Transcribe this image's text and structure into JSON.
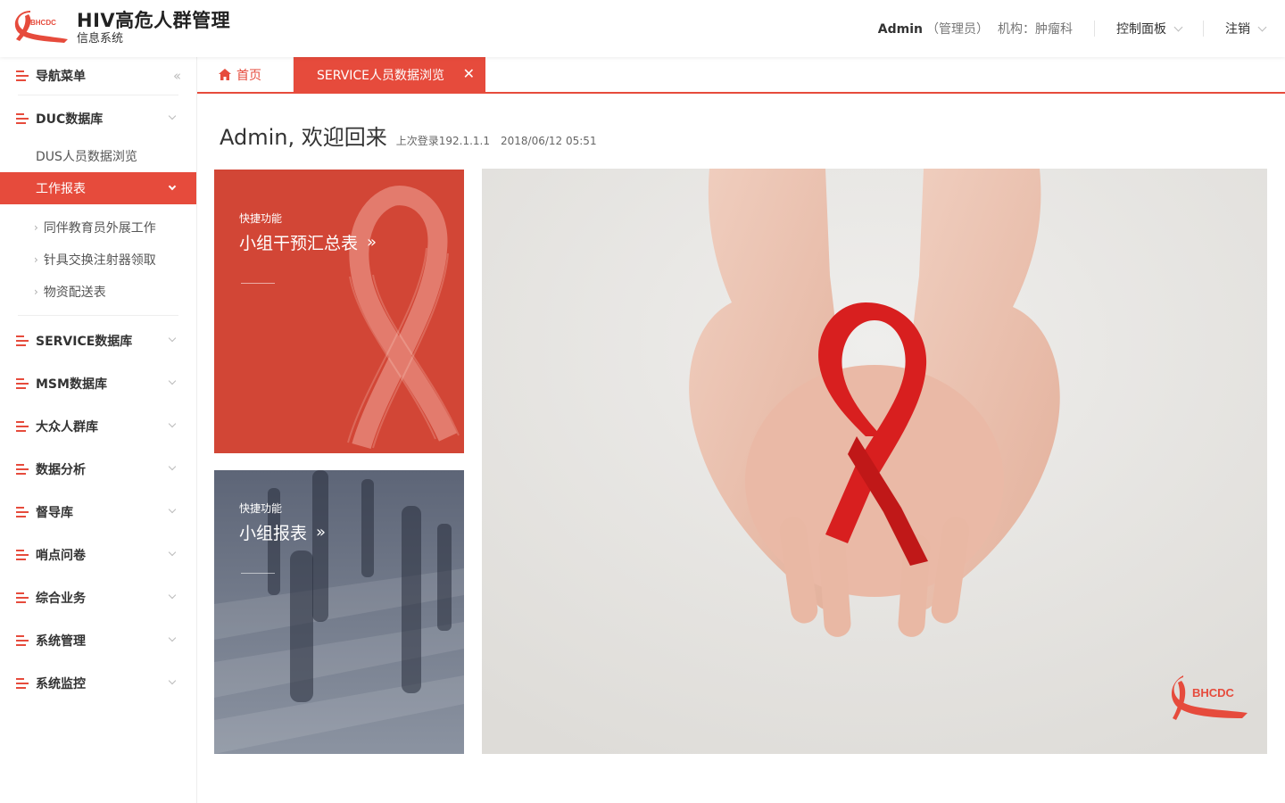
{
  "header": {
    "logo_text": "BHCDC",
    "title": "HIV高危人群管理",
    "subtitle": "信息系统",
    "user": "Admin",
    "role": "（管理员）",
    "org": "机构：肿瘤科",
    "control_panel": "控制面板",
    "logout": "注销"
  },
  "sidebar": {
    "nav_title": "导航菜单",
    "duc_db": "DUC数据库",
    "dus_browse": "DUS人员数据浏览",
    "work_report": "工作报表",
    "leaves": [
      "同伴教育员外展工作",
      "针具交换注射器领取",
      "物资配送表"
    ],
    "groups": [
      "SERVICE数据库",
      "MSM数据库",
      "大众人群库",
      "数据分析",
      "督导库",
      "哨点问卷",
      "综合业务",
      "系统管理",
      "系统监控"
    ]
  },
  "tabs": {
    "home": "首页",
    "active": "SERVICE人员数据浏览"
  },
  "welcome": {
    "greeting": "Admin, 欢迎回来",
    "last_login": "上次登录192.1.1.1",
    "datetime": "2018/06/12   05:51"
  },
  "cards": [
    {
      "label": "快捷功能",
      "title": "小组干预汇总表",
      "arrow": "»"
    },
    {
      "label": "快捷功能",
      "title": "小组报表",
      "arrow": "»"
    }
  ],
  "hero": {
    "logo_text": "BHCDC"
  },
  "colors": {
    "accent": "#e64b3c",
    "card_red": "#d24636",
    "card_gray": "#6d7586"
  }
}
